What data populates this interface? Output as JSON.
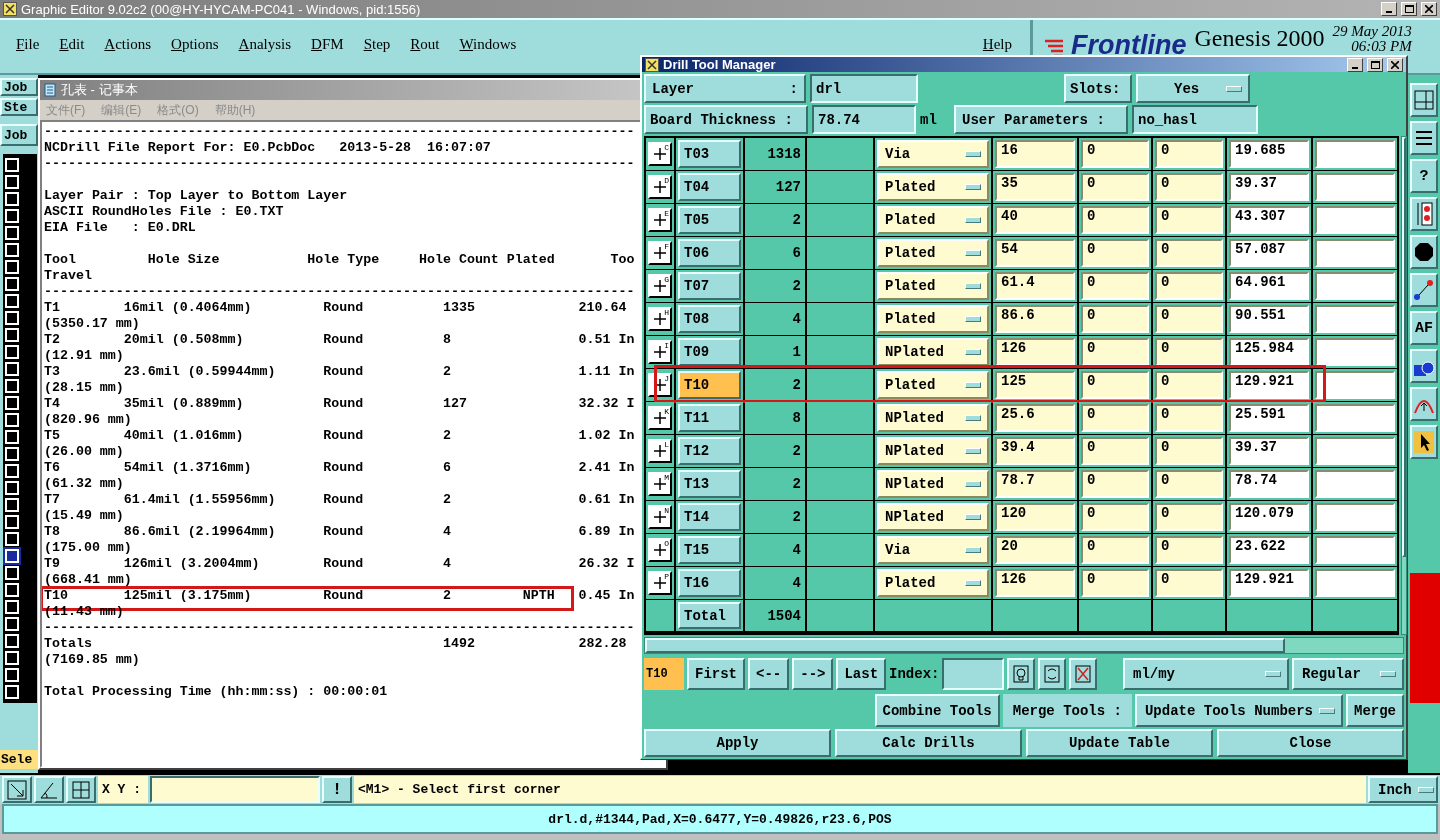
{
  "app": {
    "title": "Graphic Editor 9.02c2 (00@HY-HYCAM-PC041 - Windows, pid:1556)",
    "menu": [
      "File",
      "Edit",
      "Actions",
      "Options",
      "Analysis",
      "DFM",
      "Step",
      "Rout",
      "Windows"
    ],
    "help": "Help",
    "brand": {
      "logo": "Frontline",
      "product": "Genesis 2000",
      "date": "29 May 2013",
      "time": "06:03 PM"
    }
  },
  "left_panel": {
    "buttons": [
      "Job",
      "Ste",
      "Job"
    ],
    "mode": "Sele",
    "layers": [
      {
        "selected": false
      },
      {
        "selected": false
      },
      {
        "selected": false
      },
      {
        "selected": false
      },
      {
        "selected": false
      },
      {
        "selected": false
      },
      {
        "selected": false
      },
      {
        "selected": false
      },
      {
        "selected": false
      },
      {
        "selected": false
      },
      {
        "selected": false
      },
      {
        "selected": false
      },
      {
        "selected": false
      },
      {
        "selected": false
      },
      {
        "selected": false
      },
      {
        "selected": false
      },
      {
        "selected": false
      },
      {
        "selected": false
      },
      {
        "selected": false
      },
      {
        "selected": false
      },
      {
        "selected": false
      },
      {
        "selected": false
      },
      {
        "selected": false
      },
      {
        "selected": true
      },
      {
        "selected": false
      },
      {
        "selected": false
      },
      {
        "selected": false
      },
      {
        "selected": false
      },
      {
        "selected": false
      },
      {
        "selected": false
      },
      {
        "selected": false
      },
      {
        "selected": false
      }
    ]
  },
  "right_toolbar": [
    {
      "kind": "grid"
    },
    {
      "kind": "lines"
    },
    {
      "kind": "label",
      "label": "?"
    },
    {
      "kind": "traffic"
    },
    {
      "kind": "octagon"
    },
    {
      "kind": "arrow"
    },
    {
      "kind": "label",
      "label": "AF"
    },
    {
      "kind": "shapes"
    },
    {
      "kind": "arc"
    },
    {
      "kind": "cursor"
    }
  ],
  "notepad": {
    "title": "孔表 - 记事本",
    "menu": [
      "文件(F)",
      "编辑(E)",
      "格式(O)",
      "帮助(H)"
    ],
    "sections": [
      {
        "lines": [
          {
            "text": "--------------------------------------------------------------------------",
            "highlighted": false
          },
          {
            "text": "NCDrill File Report For: E0.PcbDoc   2013-5-28  16:07:07",
            "highlighted": false
          },
          {
            "text": "--------------------------------------------------------------------------",
            "highlighted": false
          }
        ]
      },
      {
        "lines": [
          {
            "text": "Layer Pair : Top Layer to Bottom Layer",
            "highlighted": false
          },
          {
            "text": "ASCII RoundHoles File : E0.TXT",
            "highlighted": false
          },
          {
            "text": "EIA File   : E0.DRL",
            "highlighted": false
          }
        ]
      },
      {
        "lines": [
          {
            "text": "Tool         Hole Size           Hole Type     Hole Count Plated       Too",
            "highlighted": false
          },
          {
            "text": "Travel",
            "highlighted": false
          },
          {
            "text": "--------------------------------------------------------------------------",
            "highlighted": false
          },
          {
            "text": "T1        16mil (0.4064mm)         Round          1335             210.64",
            "highlighted": false
          },
          {
            "text": "(5350.17 mm)",
            "highlighted": false
          },
          {
            "text": "T2        20mil (0.508mm)          Round          8                0.51 In",
            "highlighted": false
          },
          {
            "text": "(12.91 mm)",
            "highlighted": false
          },
          {
            "text": "T3        23.6mil (0.59944mm)      Round          2                1.11 In",
            "highlighted": false
          },
          {
            "text": "(28.15 mm)",
            "highlighted": false
          },
          {
            "text": "T4        35mil (0.889mm)          Round          127              32.32 I",
            "highlighted": false
          },
          {
            "text": "(820.96 mm)",
            "highlighted": false
          },
          {
            "text": "T5        40mil (1.016mm)          Round          2                1.02 In",
            "highlighted": false
          },
          {
            "text": "(26.00 mm)",
            "highlighted": false
          },
          {
            "text": "T6        54mil (1.3716mm)         Round          6                2.41 In",
            "highlighted": false
          },
          {
            "text": "(61.32 mm)",
            "highlighted": false
          },
          {
            "text": "T7        61.4mil (1.55956mm)      Round          2                0.61 In",
            "highlighted": false
          },
          {
            "text": "(15.49 mm)",
            "highlighted": false
          },
          {
            "text": "T8        86.6mil (2.19964mm)      Round          4                6.89 In",
            "highlighted": false
          },
          {
            "text": "(175.00 mm)",
            "highlighted": false
          },
          {
            "text": "T9        126mil (3.2004mm)        Round          4                26.32 I",
            "highlighted": false
          },
          {
            "text": "(668.41 mm)",
            "highlighted": false
          },
          {
            "text": "T10       125mil (3.175mm)         Round          2         NPTH   0.45 In",
            "highlighted": true
          },
          {
            "text": "(11.43 mm)",
            "highlighted": false
          },
          {
            "text": "--------------------------------------------------------------------------",
            "highlighted": false
          },
          {
            "text": "Totals                                            1492             282.28",
            "highlighted": false
          },
          {
            "text": "(7169.85 mm)",
            "highlighted": false
          }
        ]
      },
      {
        "lines": [
          {
            "text": "Total Processing Time (hh:mm:ss) : 00:00:01",
            "highlighted": false
          }
        ]
      }
    ]
  },
  "drill_tool_manager": {
    "title": "Drill Tool Manager",
    "layer": {
      "label": "Layer",
      "colon": ":",
      "value": "drl"
    },
    "slots": {
      "label": "Slots:",
      "value": "Yes"
    },
    "board_thickness": {
      "label": "Board Thickness :",
      "value": "78.74",
      "unit": "ml"
    },
    "user_parameters": {
      "label": "User Parameters :",
      "value": "no_hasl"
    },
    "rows": [
      {
        "marker": "C",
        "tool": "T03",
        "count": "1318",
        "type": "Via",
        "column_6": "16",
        "column_7": "0",
        "column_8": "0",
        "column_9": "19.685",
        "selected": false,
        "highlighted": false
      },
      {
        "marker": "D",
        "tool": "T04",
        "count": "127",
        "type": "Plated",
        "column_6": "35",
        "column_7": "0",
        "column_8": "0",
        "column_9": "39.37",
        "selected": false,
        "highlighted": false
      },
      {
        "marker": "E",
        "tool": "T05",
        "count": "2",
        "type": "Plated",
        "column_6": "40",
        "column_7": "0",
        "column_8": "0",
        "column_9": "43.307",
        "selected": false,
        "highlighted": false
      },
      {
        "marker": "F",
        "tool": "T06",
        "count": "6",
        "type": "Plated",
        "column_6": "54",
        "column_7": "0",
        "column_8": "0",
        "column_9": "57.087",
        "selected": false,
        "highlighted": false
      },
      {
        "marker": "G",
        "tool": "T07",
        "count": "2",
        "type": "Plated",
        "column_6": "61.4",
        "column_7": "0",
        "column_8": "0",
        "column_9": "64.961",
        "selected": false,
        "highlighted": false
      },
      {
        "marker": "H",
        "tool": "T08",
        "count": "4",
        "type": "Plated",
        "column_6": "86.6",
        "column_7": "0",
        "column_8": "0",
        "column_9": "90.551",
        "selected": false,
        "highlighted": false
      },
      {
        "marker": "I",
        "tool": "T09",
        "count": "1",
        "type": "NPlated",
        "column_6": "126",
        "column_7": "0",
        "column_8": "0",
        "column_9": "125.984",
        "selected": false,
        "highlighted": false
      },
      {
        "marker": "J",
        "tool": "T10",
        "count": "2",
        "type": "Plated",
        "column_6": "125",
        "column_7": "0",
        "column_8": "0",
        "column_9": "129.921",
        "selected": true,
        "highlighted": true
      },
      {
        "marker": "K",
        "tool": "T11",
        "count": "8",
        "type": "NPlated",
        "column_6": "25.6",
        "column_7": "0",
        "column_8": "0",
        "column_9": "25.591",
        "selected": false,
        "highlighted": false
      },
      {
        "marker": "L",
        "tool": "T12",
        "count": "2",
        "type": "NPlated",
        "column_6": "39.4",
        "column_7": "0",
        "column_8": "0",
        "column_9": "39.37",
        "selected": false,
        "highlighted": false
      },
      {
        "marker": "M",
        "tool": "T13",
        "count": "2",
        "type": "NPlated",
        "column_6": "78.7",
        "column_7": "0",
        "column_8": "0",
        "column_9": "78.74",
        "selected": false,
        "highlighted": false
      },
      {
        "marker": "N",
        "tool": "T14",
        "count": "2",
        "type": "NPlated",
        "column_6": "120",
        "column_7": "0",
        "column_8": "0",
        "column_9": "120.079",
        "selected": false,
        "highlighted": false
      },
      {
        "marker": "O",
        "tool": "T15",
        "count": "4",
        "type": "Via",
        "column_6": "20",
        "column_7": "0",
        "column_8": "0",
        "column_9": "23.622",
        "selected": false,
        "highlighted": false
      },
      {
        "marker": "P",
        "tool": "T16",
        "count": "4",
        "type": "Plated",
        "column_6": "126",
        "column_7": "0",
        "column_8": "0",
        "column_9": "129.921",
        "selected": false,
        "highlighted": false
      }
    ],
    "total": {
      "label": "Total",
      "count": "1504"
    },
    "current_tool": "T10",
    "navigation": [
      "First",
      "<--",
      "-->",
      "Last"
    ],
    "index_label": "Index:",
    "units": "ml/my",
    "mode": "Regular",
    "combine": "Combine Tools",
    "merge_label": "Merge Tools :",
    "merge_mode": "Update Tools Numbers",
    "merge": "Merge",
    "actions": [
      "Apply",
      "Calc Drills",
      "Update Table",
      "Close"
    ]
  },
  "status": {
    "xy_label": "X Y :",
    "alert": "!",
    "prompt": "<M1> - Select first corner",
    "units": "Inch",
    "info": "drl.d,#1344,Pad,X=0.6477,Y=0.49826,r23.6,POS"
  }
}
